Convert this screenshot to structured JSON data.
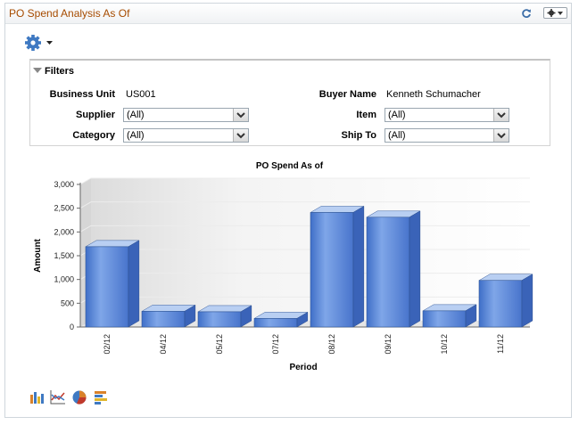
{
  "pagelet": {
    "title": "PO Spend Analysis As Of",
    "refresh_icon": "refresh-icon",
    "options_icon": "gear-icon"
  },
  "actions_menu": {
    "icon": "gear-icon"
  },
  "filters": {
    "title": "Filters",
    "business_unit": {
      "label": "Business Unit",
      "value": "US001"
    },
    "buyer_name": {
      "label": "Buyer Name",
      "value": "Kenneth Schumacher"
    },
    "supplier": {
      "label": "Supplier",
      "value": "(All)"
    },
    "item": {
      "label": "Item",
      "value": "(All)"
    },
    "category": {
      "label": "Category",
      "value": "(All)"
    },
    "ship_to": {
      "label": "Ship To",
      "value": "(All)"
    }
  },
  "chart_data": {
    "type": "bar",
    "title": "PO Spend As of",
    "xlabel": "Period",
    "ylabel": "Amount",
    "categories": [
      "02/12",
      "04/12",
      "05/12",
      "07/12",
      "08/12",
      "09/12",
      "10/12",
      "11/12"
    ],
    "values": [
      1690,
      330,
      320,
      180,
      2410,
      2310,
      340,
      980
    ],
    "yticks": [
      "0",
      "500",
      "1,000",
      "1,500",
      "2,000",
      "2,500",
      "3,000"
    ],
    "ylim": [
      0,
      3000
    ],
    "grid": true,
    "colors": {
      "bar_front": "#5b88d8",
      "bar_top": "#b9cff2",
      "bar_side": "#3a63b8"
    }
  },
  "chart_types": [
    "bar-chart-icon",
    "line-chart-icon",
    "pie-chart-icon",
    "horizontal-bar-chart-icon"
  ]
}
